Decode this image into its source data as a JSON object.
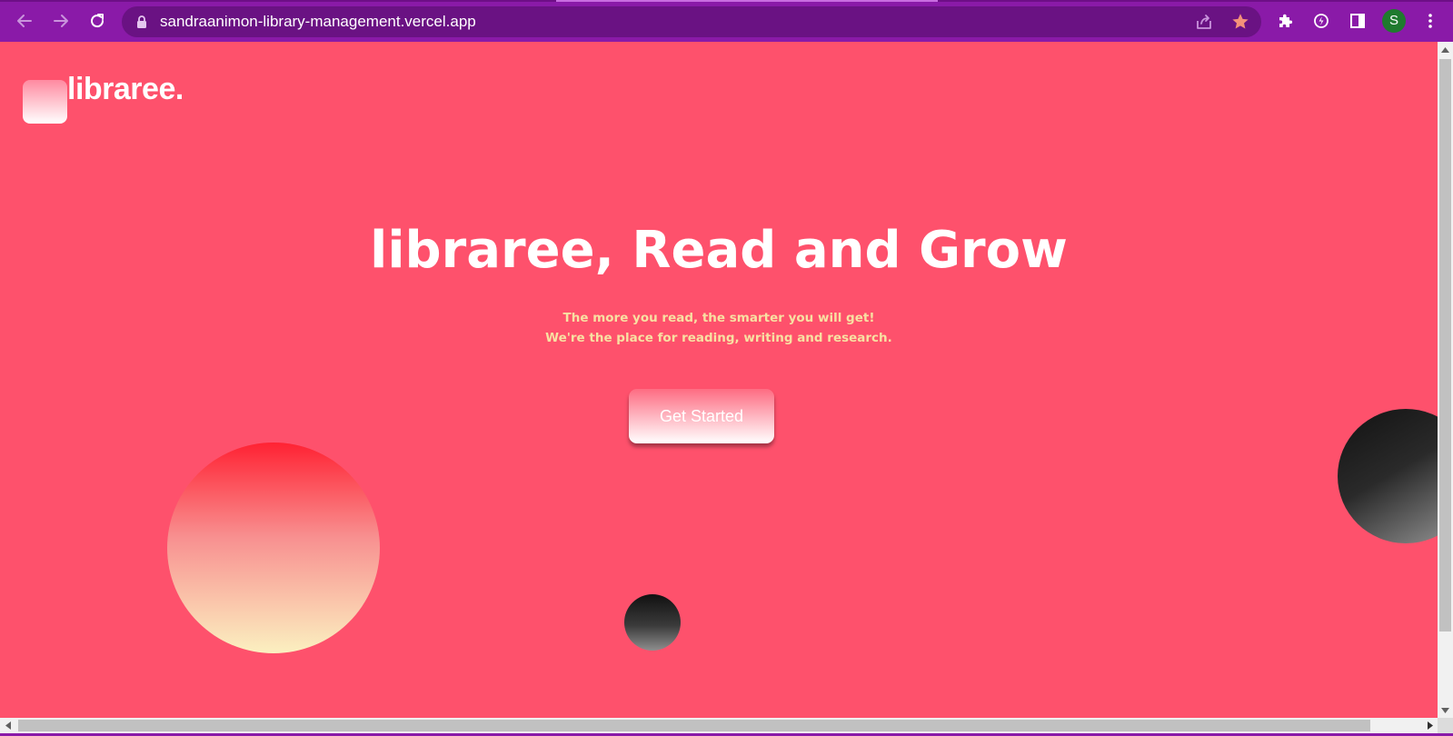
{
  "browser": {
    "url": "sandraanimon-library-management.vercel.app",
    "profile_initial": "S",
    "icons": {
      "back": "arrow-left-icon",
      "forward": "arrow-right-icon",
      "reload": "reload-icon",
      "lock": "lock-icon",
      "share": "share-icon",
      "bookmark": "star-icon",
      "extensions": "puzzle-icon",
      "performance": "leaf-icon",
      "side_panel": "side-panel-icon",
      "menu": "kebab-menu-icon"
    },
    "colors": {
      "frame": "#8a1aa8",
      "omnibox": "#6a1283",
      "star": "#f4917a",
      "avatar": "#1f7a2e"
    }
  },
  "page": {
    "logo": {
      "text": "libraree."
    },
    "hero": {
      "title": "libraree, Read and Grow",
      "subtitle_line1": "The more you read, the smarter you will get!",
      "subtitle_line2": "We're the place for reading, writing and research.",
      "cta_label": "Get Started"
    },
    "colors": {
      "background": "#fe516c",
      "title": "#ffffff",
      "subtitle": "#f8e0a2",
      "cta_text": "#ffffff"
    }
  }
}
